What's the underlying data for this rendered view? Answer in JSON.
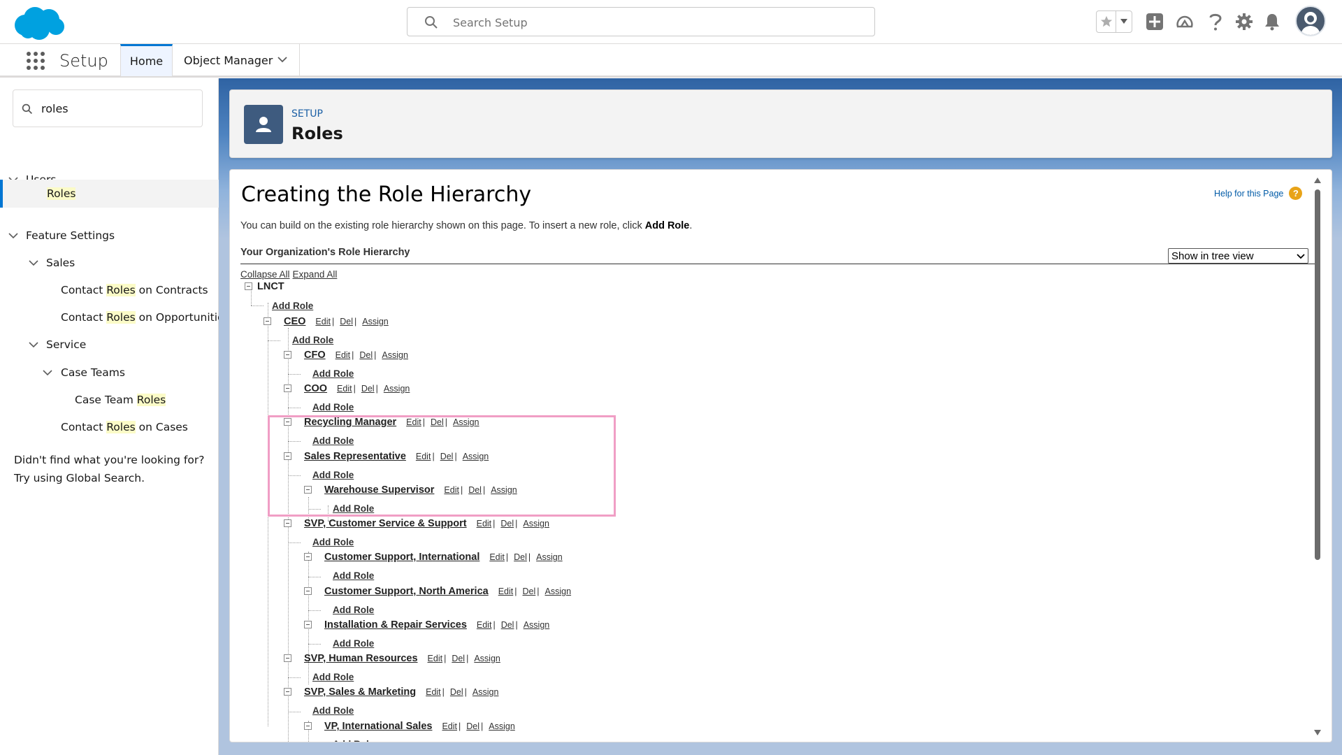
{
  "header": {
    "search_placeholder": "Search Setup",
    "brand_color": "#00a1e0"
  },
  "appnav": {
    "app_name": "Setup",
    "tabs": [
      {
        "label": "Home",
        "active": true
      },
      {
        "label": "Object Manager",
        "active": false
      }
    ]
  },
  "sidebar": {
    "quickfind_value": "roles",
    "items": [
      {
        "label": "Users",
        "level": 0,
        "expandable": true
      },
      {
        "pre": "",
        "match": "Roles",
        "post": "",
        "level": 1,
        "selected": true
      },
      {
        "label": "Feature Settings",
        "level": 0,
        "expandable": true
      },
      {
        "label": "Sales",
        "level": 1,
        "expandable": true
      },
      {
        "pre": "Contact ",
        "match": "Roles",
        "post": " on Contracts",
        "level": 2
      },
      {
        "pre": "Contact ",
        "match": "Roles",
        "post": " on Opportunities",
        "level": 2
      },
      {
        "label": "Service",
        "level": 1,
        "expandable": true
      },
      {
        "label": "Case Teams",
        "level": 2,
        "expandable": true
      },
      {
        "pre": "Case Team ",
        "match": "Roles",
        "post": "",
        "level": 3
      },
      {
        "pre": "Contact ",
        "match": "Roles",
        "post": " on Cases",
        "level": 2
      }
    ],
    "not_found_line1": "Didn't find what you're looking for?",
    "not_found_line2": "Try using Global Search."
  },
  "page_header": {
    "eyebrow": "SETUP",
    "title": "Roles"
  },
  "content": {
    "title": "Creating the Role Hierarchy",
    "help_link": "Help for this Page",
    "help_icon": "?",
    "intro_text": "You can build on the existing role hierarchy shown on this page. To insert a new role, click ",
    "intro_bold": "Add Role",
    "intro_end": ".",
    "section_title": "Your Organization's Role Hierarchy",
    "view_select": "Show in tree view",
    "collapse_all": "Collapse All",
    "expand_all": "Expand All",
    "actions": {
      "edit": "Edit",
      "del": "Del",
      "assign": "Assign",
      "sep": "|"
    },
    "add_role": "Add Role",
    "tree": [
      {
        "name": "LNCT",
        "actions": false
      },
      {
        "name": "CEO",
        "actions": true
      },
      {
        "name": "CFO",
        "actions": true
      },
      {
        "name": "COO",
        "actions": true
      },
      {
        "name": "Recycling Manager",
        "actions": true
      },
      {
        "name": "Sales Representative",
        "actions": true
      },
      {
        "name": "Warehouse Supervisor",
        "actions": true
      },
      {
        "name": "SVP, Customer Service & Support",
        "actions": true
      },
      {
        "name": "Customer Support, International",
        "actions": true
      },
      {
        "name": "Customer Support, North America",
        "actions": true
      },
      {
        "name": "Installation & Repair Services",
        "actions": true
      },
      {
        "name": "SVP, Human Resources",
        "actions": true
      },
      {
        "name": "SVP, Sales & Marketing",
        "actions": true
      },
      {
        "name": "VP, International Sales",
        "actions": true
      }
    ]
  }
}
